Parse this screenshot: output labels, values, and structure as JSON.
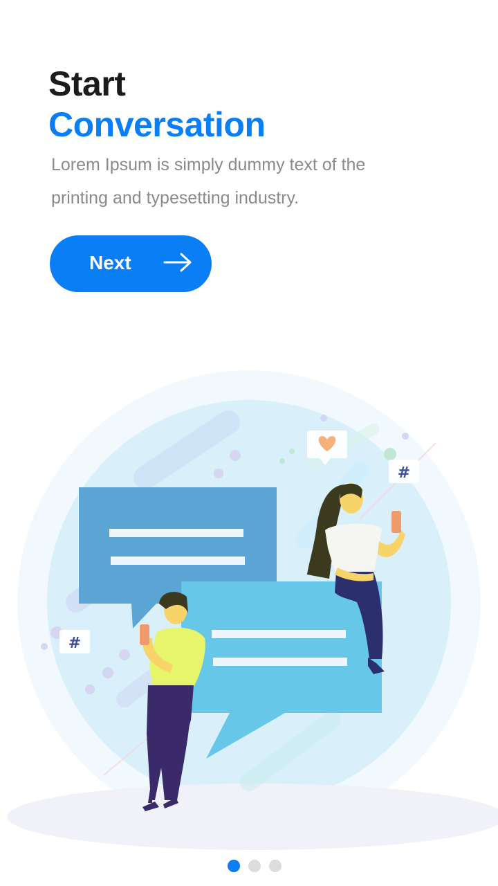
{
  "heading": {
    "line1": "Start",
    "line2": "Conversation"
  },
  "subtitle": "Lorem Ipsum is simply dummy text of the printing and typesetting industry.",
  "next_button": {
    "label": "Next",
    "icon": "arrow-right-icon"
  },
  "pagination": {
    "total": 3,
    "active": 1
  },
  "colors": {
    "accent": "#0a7ff5",
    "heading": "#1b1b1b",
    "subtitle": "#8a8a8a",
    "dot_inactive": "#dcdcdc"
  }
}
